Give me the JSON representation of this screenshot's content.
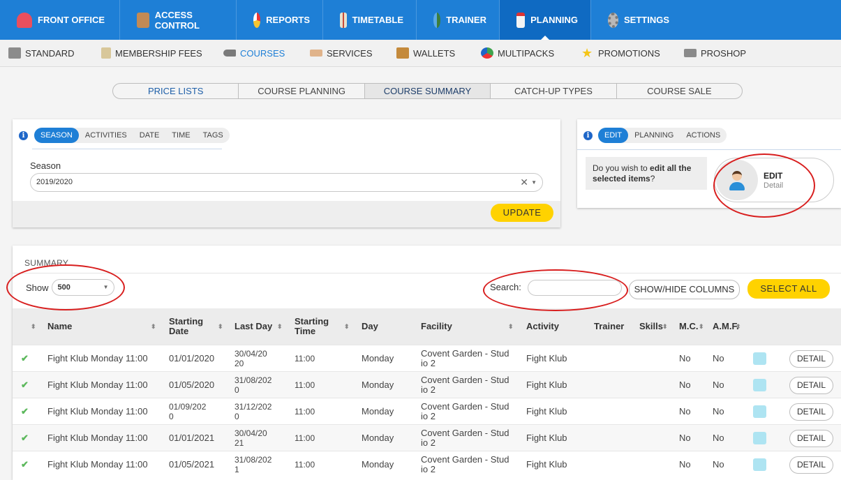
{
  "topnav": {
    "items": [
      {
        "label": "FRONT OFFICE",
        "icon": "receptionist-icon",
        "color": "#e94f5e"
      },
      {
        "label": "ACCESS CONTROL",
        "icon": "access-person-icon",
        "color": "#c28a55"
      },
      {
        "label": "REPORTS",
        "icon": "pie-chart-icon",
        "color": "#f7c531"
      },
      {
        "label": "TIMETABLE",
        "icon": "calendar-grid-icon",
        "color": "#e8e0cc"
      },
      {
        "label": "TRAINER",
        "icon": "trainer-people-icon",
        "color": "#5aa9e6"
      },
      {
        "label": "PLANNING",
        "icon": "calendar-icon",
        "color": "#f4f4f4"
      },
      {
        "label": "SETTINGS",
        "icon": "gear-icon",
        "color": "#b8b8b8"
      }
    ],
    "active_index": 5
  },
  "subnav": {
    "items": [
      {
        "label": "STANDARD",
        "icon": "box-icon",
        "color": "#8c8c8c"
      },
      {
        "label": "MEMBERSHIP FEES",
        "icon": "document-icon",
        "color": "#d8c79a"
      },
      {
        "label": "COURSES",
        "icon": "sneaker-icon",
        "color": "#7a7a7a"
      },
      {
        "label": "SERVICES",
        "icon": "handshake-icon",
        "color": "#e0b38a"
      },
      {
        "label": "WALLETS",
        "icon": "wallet-icon",
        "color": "#c48a3c"
      },
      {
        "label": "MULTIPACKS",
        "icon": "multipack-icon",
        "color": "#3fa34d"
      },
      {
        "label": "PROMOTIONS",
        "icon": "star-icon",
        "color": "#f5c518"
      },
      {
        "label": "PROSHOP",
        "icon": "shop-icon",
        "color": "#8a8a8a"
      }
    ],
    "active_index": 2
  },
  "segments": {
    "items": [
      "PRICE LISTS",
      "COURSE PLANNING",
      "COURSE SUMMARY",
      "CATCH-UP TYPES",
      "COURSE SALE"
    ],
    "active_index": 2
  },
  "filter_panel": {
    "tabs": [
      "SEASON",
      "ACTIVITIES",
      "DATE",
      "TIME",
      "TAGS"
    ],
    "season_label": "Season",
    "season_value": "2019/2020",
    "clear_glyph": "✕",
    "update_label": "UPDATE"
  },
  "edit_panel": {
    "tabs": [
      "EDIT",
      "PLANNING",
      "ACTIONS"
    ],
    "question_pre": "Do you wish to ",
    "question_bold": "edit all the selected items",
    "question_post": "?",
    "card_title": "EDIT",
    "card_subtitle": "Detail"
  },
  "summary": {
    "title": "SUMMARY",
    "show_label": "Show",
    "show_value": "500",
    "search_label": "Search:",
    "search_value": "",
    "show_hide_label": "SHOW/HIDE COLUMNS",
    "select_all_label": "SELECT ALL",
    "columns": {
      "name": "Name",
      "start_date": "Starting Date",
      "last_day": "Last Day",
      "start_time": "Starting Time",
      "day": "Day",
      "facility": "Facility",
      "activity": "Activity",
      "trainer": "Trainer",
      "skills": "Skills",
      "mc": "M.C.",
      "amf": "A.M.F."
    },
    "detail_label": "DETAIL",
    "row_color": "#aee4f2",
    "rows": [
      {
        "name": "Fight Klub Monday 11:00",
        "start_date": "01/01/2020",
        "last_day": "30/04/20\n20",
        "start_time": "11:00",
        "day": "Monday",
        "facility": "Covent Garden - Stud\nio 2",
        "activity": "Fight Klub",
        "trainer": "",
        "skills": "",
        "mc": "No",
        "amf": "No"
      },
      {
        "name": "Fight Klub Monday 11:00",
        "start_date": "01/05/2020",
        "last_day": "31/08/202\n0",
        "start_time": "11:00",
        "day": "Monday",
        "facility": "Covent Garden - Stud\nio 2",
        "activity": "Fight Klub",
        "trainer": "",
        "skills": "",
        "mc": "No",
        "amf": "No"
      },
      {
        "name": "Fight Klub Monday 11:00",
        "start_date": "01/09/202\n0",
        "last_day": "31/12/202\n0",
        "start_time": "11:00",
        "day": "Monday",
        "facility": "Covent Garden - Stud\nio 2",
        "activity": "Fight Klub",
        "trainer": "",
        "skills": "",
        "mc": "No",
        "amf": "No"
      },
      {
        "name": "Fight Klub Monday 11:00",
        "start_date": "01/01/2021",
        "last_day": "30/04/20\n21",
        "start_time": "11:00",
        "day": "Monday",
        "facility": "Covent Garden - Stud\nio 2",
        "activity": "Fight Klub",
        "trainer": "",
        "skills": "",
        "mc": "No",
        "amf": "No"
      },
      {
        "name": "Fight Klub Monday 11:00",
        "start_date": "01/05/2021",
        "last_day": "31/08/202\n1",
        "start_time": "11:00",
        "day": "Monday",
        "facility": "Covent Garden - Stud\nio 2",
        "activity": "Fight Klub",
        "trainer": "",
        "skills": "",
        "mc": "No",
        "amf": "No"
      }
    ]
  }
}
